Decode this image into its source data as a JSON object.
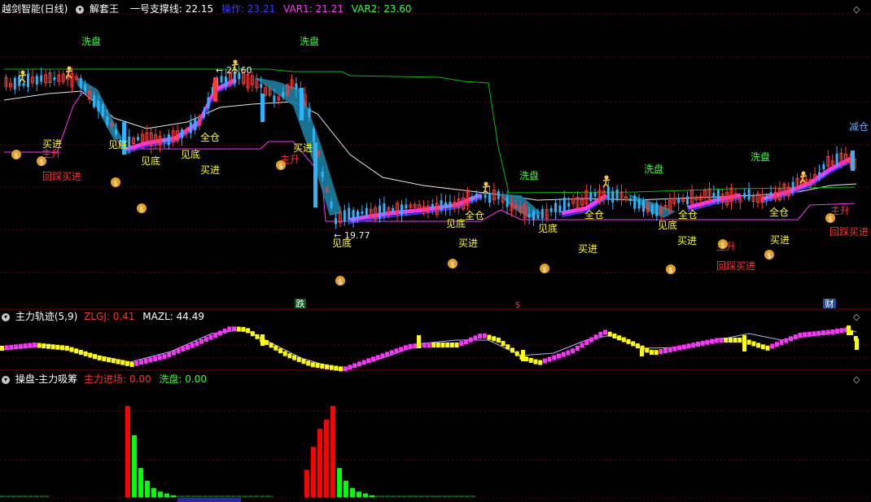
{
  "colors": {
    "bg": "#000000",
    "grid": "#7a0000",
    "up_candle": "#ff3b3b",
    "down_candle": "#27b6ff",
    "line_white": "#e8e8e8",
    "green_line": "#00c000",
    "magenta": "#ff33ff",
    "ribbon": "#1c7ea0",
    "yellow": "#ffff00",
    "red_label": "#ff3030",
    "green_label": "#33ff33",
    "blue_label": "#2222ff"
  },
  "header_main": {
    "indicator": "越剑智能(日线)",
    "sub": "解套王",
    "line1_label": "一号支撑线:",
    "line1_value": "22.15",
    "op_label": "操作:",
    "op_value": "23.21",
    "var1_label": "VAR1:",
    "var1_value": "21.21",
    "var2_label": "VAR2:",
    "var2_value": "23.60"
  },
  "header_mid": {
    "title": "主力轨迹(5,9)",
    "zlgj_label": "ZLGJ:",
    "zlgj_value": "0.41",
    "mazl_label": "MAZL:",
    "mazl_value": "44.49"
  },
  "header_bot": {
    "title": "操盘-主力吸筹",
    "in_label": "主力进场:",
    "in_value": "0.00",
    "wash_label": "洗盘:",
    "wash_value": "0.00"
  },
  "right_icon": "diamond-icon",
  "annotations": {
    "wash": "洗盘",
    "buy": "买进",
    "bottom": "见底",
    "full": "全仓",
    "rise": "主升",
    "pullback_buy": "回踩买进",
    "reduce": "减仓",
    "high_label": "21.60",
    "low_label": "19.77",
    "fall_marker": "跌",
    "dollar_marker": "$",
    "wealth_marker": "财"
  },
  "chart_data": {
    "type": "candlestick",
    "price_panel": {
      "high_marked": 21.6,
      "low_marked": 19.77,
      "support_line_1": 22.15,
      "op": 23.21,
      "var1": 21.21,
      "var2": 23.6
    },
    "mid_panel": {
      "zlgj": 0.41,
      "mazl": 44.49
    },
    "bottom_panel": {
      "in_value": 0.0,
      "wash_value": 0.0,
      "red_bars_1": [
        100
      ],
      "green_bars_1": [
        68,
        32,
        18,
        10,
        6,
        4,
        2
      ],
      "red_bars_2": [
        30,
        55,
        75,
        85,
        100
      ],
      "green_bars_2": [
        32,
        18,
        10,
        6,
        4,
        2
      ]
    },
    "grid": true
  }
}
